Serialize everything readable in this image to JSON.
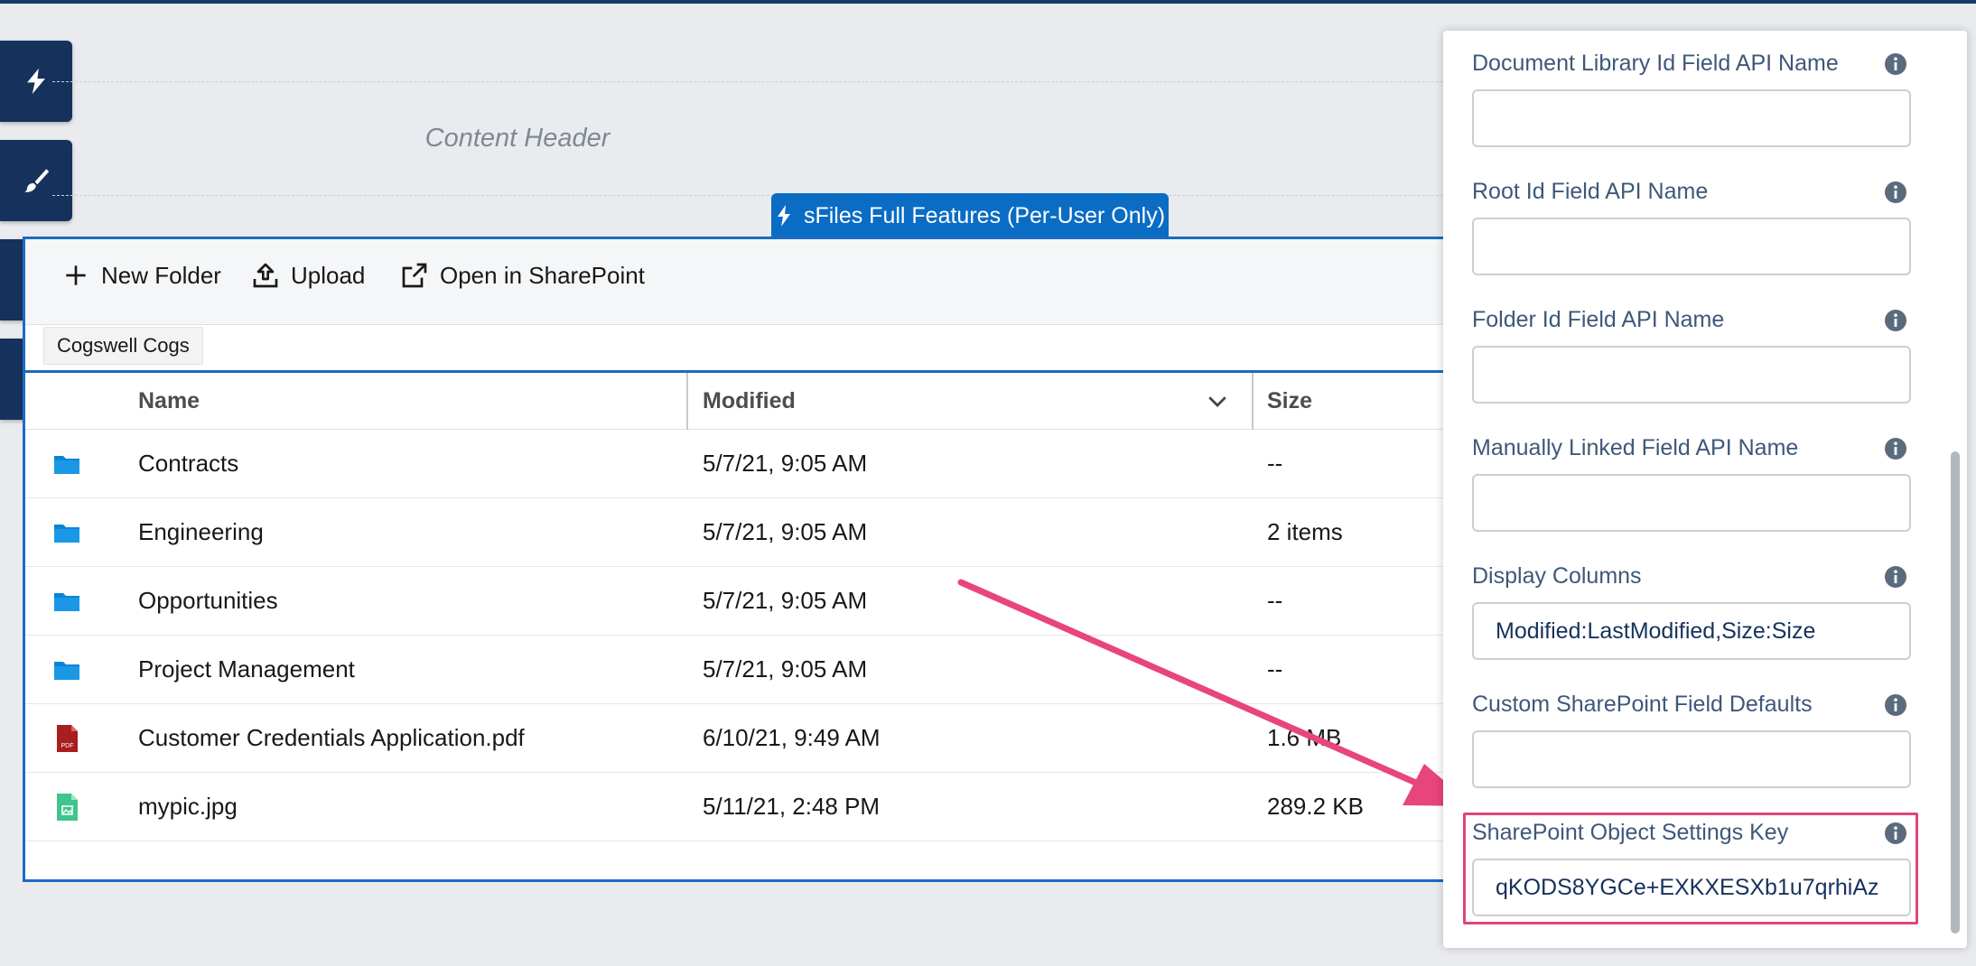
{
  "rail": {
    "buttons": [
      {
        "icon": "lightning-icon"
      },
      {
        "icon": "brush-icon"
      },
      {
        "icon": "list-icon"
      },
      {
        "icon": "gear-icon"
      }
    ]
  },
  "content_header": {
    "label": "Content Header"
  },
  "feature_tab": {
    "label": "sFiles Full Features (Per-User Only)"
  },
  "toolbar": {
    "new_folder": "New Folder",
    "upload": "Upload",
    "open_sharepoint": "Open in SharePoint"
  },
  "breadcrumb": {
    "label": "Cogswell Cogs"
  },
  "table": {
    "columns": [
      "Name",
      "Modified",
      "Size"
    ],
    "rows": [
      {
        "type": "folder",
        "name": "Contracts",
        "modified": "5/7/21, 9:05 AM",
        "size": "--"
      },
      {
        "type": "folder",
        "name": "Engineering",
        "modified": "5/7/21, 9:05 AM",
        "size": "2 items"
      },
      {
        "type": "folder",
        "name": "Opportunities",
        "modified": "5/7/21, 9:05 AM",
        "size": "--"
      },
      {
        "type": "folder",
        "name": "Project Management",
        "modified": "5/7/21, 9:05 AM",
        "size": "--"
      },
      {
        "type": "pdf",
        "name": "Customer Credentials Application.pdf",
        "modified": "6/10/21, 9:49 AM",
        "size": "1.6 MB"
      },
      {
        "type": "image",
        "name": "mypic.jpg",
        "modified": "5/11/21, 2:48 PM",
        "size": "289.2 KB"
      }
    ],
    "pdf_badge": "PDF"
  },
  "settings": {
    "fields": [
      {
        "label": "Document Library Id Field API Name",
        "value": ""
      },
      {
        "label": "Root Id Field API Name",
        "value": ""
      },
      {
        "label": "Folder Id Field API Name",
        "value": ""
      },
      {
        "label": "Manually Linked Field API Name",
        "value": ""
      },
      {
        "label": "Display Columns",
        "value": "Modified:LastModified,Size:Size"
      },
      {
        "label": "Custom SharePoint Field Defaults",
        "value": ""
      },
      {
        "label": "SharePoint Object Settings Key",
        "value": "qKODS8YGCe+EXKXESXb1u7qrhiAz"
      }
    ]
  },
  "colors": {
    "rail": "#16325c",
    "accent": "#0b6cc4",
    "highlight": "#e0457b",
    "label": "#3e5879"
  }
}
